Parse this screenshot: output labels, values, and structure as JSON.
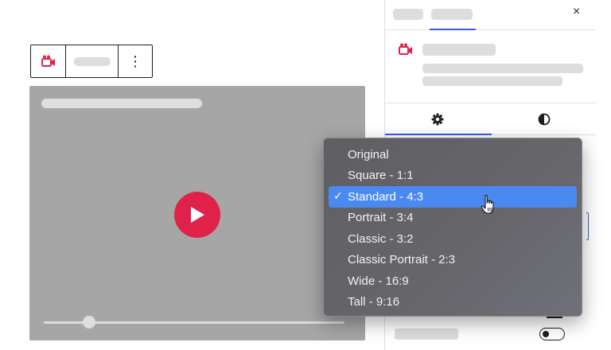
{
  "toolbar": {
    "icon": "video-camera-icon",
    "more_label": "⋮"
  },
  "video": {
    "play_icon": "play-icon"
  },
  "sidebar": {
    "close_label": "×",
    "tabs": [
      {
        "icon": "gear-icon"
      },
      {
        "icon": "half-circle-icon"
      }
    ]
  },
  "menu": {
    "selected_index": 2,
    "check_mark": "✓",
    "items": [
      {
        "label": "Original"
      },
      {
        "label": "Square - 1:1"
      },
      {
        "label": "Standard - 4:3"
      },
      {
        "label": "Portrait - 3:4"
      },
      {
        "label": "Classic - 3:2"
      },
      {
        "label": "Classic Portrait - 2:3"
      },
      {
        "label": "Wide - 16:9"
      },
      {
        "label": "Tall - 9:16"
      }
    ]
  },
  "colors": {
    "accent": "#3858e9",
    "play": "#e0224b",
    "menu_highlight": "#4a8af0"
  }
}
